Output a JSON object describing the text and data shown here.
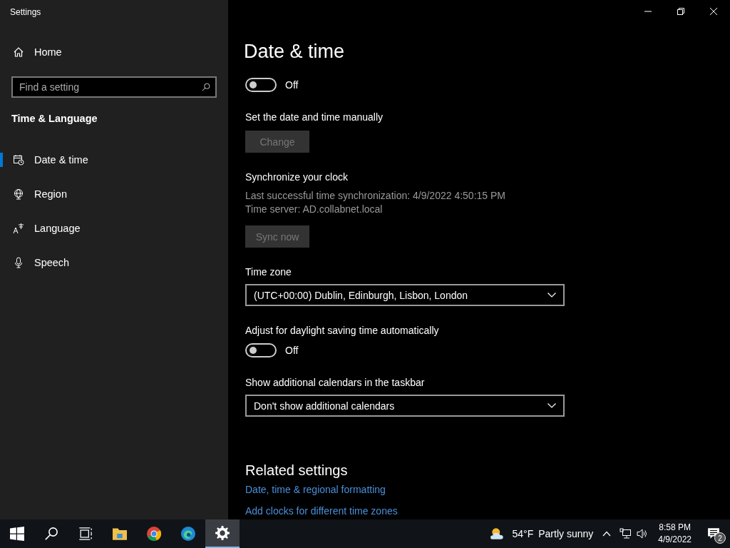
{
  "window": {
    "title": "Settings"
  },
  "sidebar": {
    "home": "Home",
    "search": {
      "placeholder": "Find a setting"
    },
    "section": "Time & Language",
    "items": [
      {
        "label": "Date & time",
        "selected": true
      },
      {
        "label": "Region",
        "selected": false
      },
      {
        "label": "Language",
        "selected": false
      },
      {
        "label": "Speech",
        "selected": false
      }
    ]
  },
  "main": {
    "title": "Date & time",
    "sections": [
      {
        "items": [
          {
            "kind": "toggle",
            "on": false,
            "state_label": "Off"
          }
        ]
      },
      {
        "items": [
          {
            "kind": "label",
            "text": "Set the date and time manually"
          },
          {
            "kind": "button",
            "text": "Change",
            "disabled": true
          }
        ]
      },
      {
        "items": [
          {
            "kind": "label",
            "text": "Synchronize your clock"
          },
          {
            "kind": "info",
            "text": "Last successful time synchronization: 4/9/2022 4:50:15 PM"
          },
          {
            "kind": "info",
            "text": "Time server: AD.collabnet.local"
          },
          {
            "kind": "button",
            "text": "Sync now",
            "disabled": true
          }
        ]
      },
      {
        "items": [
          {
            "kind": "label",
            "text": "Time zone"
          },
          {
            "kind": "dropdown",
            "value": "(UTC+00:00) Dublin, Edinburgh, Lisbon, London"
          }
        ]
      },
      {
        "items": [
          {
            "kind": "label",
            "text": "Adjust for daylight saving time automatically"
          },
          {
            "kind": "toggle",
            "on": false,
            "state_label": "Off"
          }
        ]
      },
      {
        "items": [
          {
            "kind": "label",
            "text": "Show additional calendars in the taskbar"
          },
          {
            "kind": "dropdown",
            "value": "Don't show additional calendars"
          }
        ]
      }
    ],
    "related": {
      "title": "Related settings",
      "links": [
        "Date, time & regional formatting",
        "Add clocks for different time zones"
      ]
    }
  },
  "taskbar": {
    "apps": [
      {
        "selected": false
      },
      {
        "selected": false
      },
      {
        "selected": false
      },
      {
        "selected": false
      },
      {
        "selected": false
      },
      {
        "selected": false
      },
      {
        "selected": true
      }
    ],
    "weather": {
      "temp": "54°F",
      "text": "Partly sunny"
    },
    "time": "8:58 PM",
    "date": "4/9/2022",
    "notifications": "2"
  }
}
